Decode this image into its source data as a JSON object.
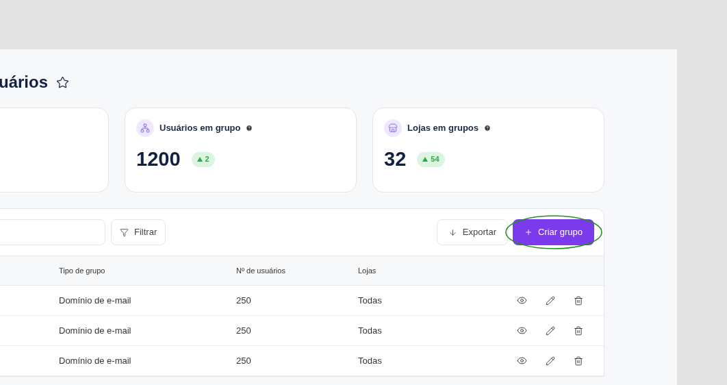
{
  "page": {
    "title": "uários"
  },
  "stats": [
    {
      "kind": "blank"
    },
    {
      "kind": "users",
      "label": "Usuários em grupo",
      "value": "1200",
      "change": "2"
    },
    {
      "kind": "stores",
      "label": "Lojas em grupos",
      "value": "32",
      "change": "54"
    }
  ],
  "toolbar": {
    "filter": "Filtrar",
    "export": "Exportar",
    "create": "Criar grupo"
  },
  "table": {
    "columns": [
      "Tipo de grupo",
      "Nº de usuários",
      "Lojas"
    ],
    "rows": [
      [
        "Domínio de e-mail",
        "250",
        "Todas"
      ],
      [
        "Domínio de e-mail",
        "250",
        "Todas"
      ],
      [
        "Domínio de e-mail",
        "250",
        "Todas"
      ]
    ]
  }
}
